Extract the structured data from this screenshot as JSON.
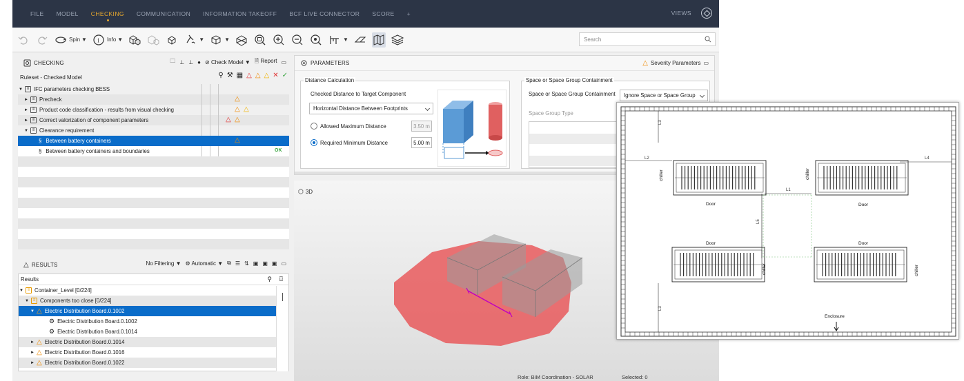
{
  "menubar": {
    "items": [
      "FILE",
      "MODEL",
      "CHECKING",
      "COMMUNICATION",
      "INFORMATION TAKEOFF",
      "BCF LIVE CONNECTOR",
      "SCORE",
      "+"
    ],
    "active": "CHECKING",
    "views_label": "VIEWS"
  },
  "toolbar": {
    "spin_label": "Spin",
    "info_label": "Info",
    "search_placeholder": "Search"
  },
  "checking": {
    "title": "CHECKING",
    "check_model_label": "Check Model",
    "report_label": "Report",
    "header_label": "Ruleset - Checked Model",
    "rows": [
      {
        "label": "IFC parameters checking BESS",
        "level": 0
      },
      {
        "label": "Precheck",
        "level": 1
      },
      {
        "label": "Product code classification - results from visual checking",
        "level": 1
      },
      {
        "label": "Correct valorization of component parameters",
        "level": 1
      },
      {
        "label": "Clearance requirement",
        "level": 1
      },
      {
        "label": "Between battery containers",
        "level": 2
      },
      {
        "label": "Between battery containers and boundaries",
        "level": 2
      }
    ],
    "ok_label": "OK"
  },
  "results": {
    "title": "RESULTS",
    "filter_label": "No Filtering",
    "automatic_label": "Automatic",
    "header_label": "Results",
    "rows": [
      {
        "label": "Container_Level [0/224]"
      },
      {
        "label": "Components too close [0/224]"
      },
      {
        "label": "Electric Distribution Board.0.1002"
      },
      {
        "label": "Electric Distribution Board.0.1002"
      },
      {
        "label": "Electric Distribution Board.0.1014"
      },
      {
        "label": "Electric Distribution Board.0.1014"
      },
      {
        "label": "Electric Distribution Board.0.1016"
      },
      {
        "label": "Electric Distribution Board.0.1022"
      }
    ]
  },
  "parameters": {
    "title": "PARAMETERS",
    "severity_label": "Severity Parameters",
    "distance_calc": {
      "legend": "Distance Calculation",
      "checked_label": "Checked Distance to Target Component",
      "dropdown_value": "Horizontal Distance Between Footprints",
      "allowed_max_label": "Allowed Maximum Distance",
      "allowed_max_value": "3.50 m",
      "required_min_label": "Required Minimum Distance",
      "required_min_value": "5.00 m"
    },
    "containment": {
      "legend": "Space or Space Group Containment",
      "label": "Space or Space Group Containment",
      "dropdown_value": "Ignore Space or Space Group",
      "group_type_label": "Space Group Type"
    }
  },
  "viewport": {
    "label": "3D",
    "role_status": "Role: BIM Coordination - SOLAR",
    "selected_status": "Selected: 0"
  },
  "floorplan": {
    "chiller_label": "chiller",
    "door_label": "Door",
    "enclosure_label": "Enclosure",
    "dims": [
      "L1",
      "L2",
      "L3",
      "L4",
      "L5"
    ]
  },
  "colors": {
    "menubar_bg": "#2c3546",
    "accent": "#e8a92d",
    "selection": "#0a6cc9",
    "severity_red": "#e03030",
    "severity_orange": "#f08a00",
    "clash_red": "#e8474a"
  }
}
